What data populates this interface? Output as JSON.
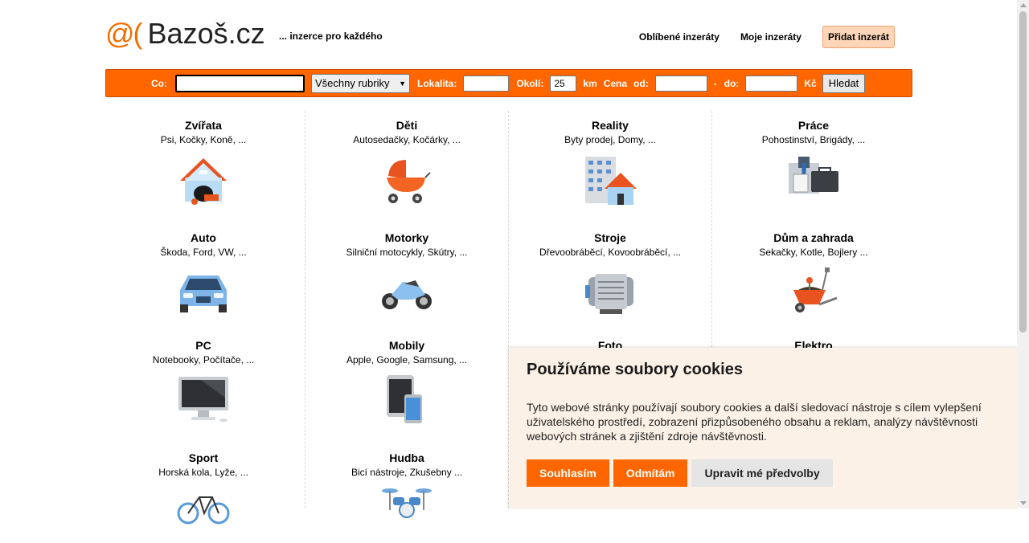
{
  "header": {
    "logo_mark": "@(",
    "logo_text": "Bazoš.cz",
    "tagline": "... inzerce pro každého",
    "links": [
      "Oblíbené inzeráty",
      "Moje inzeráty"
    ],
    "add_button": "Přidat inzerát"
  },
  "search": {
    "what_label": "Co:",
    "what_value": "",
    "category_selected": "Všechny rubriky",
    "location_label": "Lokalita:",
    "location_value": "",
    "radius_label": "Okolí:",
    "radius_value": "25",
    "radius_unit": "km",
    "price_label": "Cena",
    "from_label": "od:",
    "dash": "-",
    "to_label": "do:",
    "currency": "Kč",
    "submit": "Hledat"
  },
  "categories": [
    {
      "title": "Zvířata",
      "sub": "Psi, Kočky, Koně, ...",
      "icon": "doghouse-icon"
    },
    {
      "title": "Děti",
      "sub": "Autosedačky, Kočárky, ...",
      "icon": "stroller-icon"
    },
    {
      "title": "Reality",
      "sub": "Byty prodej, Domy, ...",
      "icon": "buildings-icon"
    },
    {
      "title": "Práce",
      "sub": "Pohostinství, Brigády, ...",
      "icon": "briefcase-icon"
    },
    {
      "title": "Auto",
      "sub": "Škoda, Ford, VW, ...",
      "icon": "car-icon"
    },
    {
      "title": "Motorky",
      "sub": "Silniční motocykly, Skútry, ...",
      "icon": "motorcycle-icon"
    },
    {
      "title": "Stroje",
      "sub": "Dřevoobráběcí, Kovoobráběcí, ...",
      "icon": "machine-icon"
    },
    {
      "title": "Dům a zahrada",
      "sub": "Sekačky, Kotle, Bojlery ...",
      "icon": "wheelbarrow-icon"
    },
    {
      "title": "PC",
      "sub": "Notebooky, Počítače, ...",
      "icon": "monitor-icon"
    },
    {
      "title": "Mobily",
      "sub": "Apple, Google, Samsung, ...",
      "icon": "phone-icon"
    },
    {
      "title": "Foto",
      "sub": "",
      "icon": ""
    },
    {
      "title": "Elektro",
      "sub": "",
      "icon": ""
    },
    {
      "title": "Sport",
      "sub": "Horská kola, Lyže, ...",
      "icon": "bicycle-icon"
    },
    {
      "title": "Hudba",
      "sub": "Bicí nástroje, Zkušebny ...",
      "icon": "drums-icon"
    }
  ],
  "cookie": {
    "title": "Používáme soubory cookies",
    "text": "Tyto webové stránky používají soubory cookies a další sledovací nástroje s cílem vylepšení uživatelského prostředí, zobrazení přizpůsobeného obsahu a reklam, analýzy návštěvnosti webových stránek a zjištění zdroje návštěvnosti.",
    "accept": "Souhlasím",
    "reject": "Odmítám",
    "settings": "Upravit mé předvolby"
  }
}
